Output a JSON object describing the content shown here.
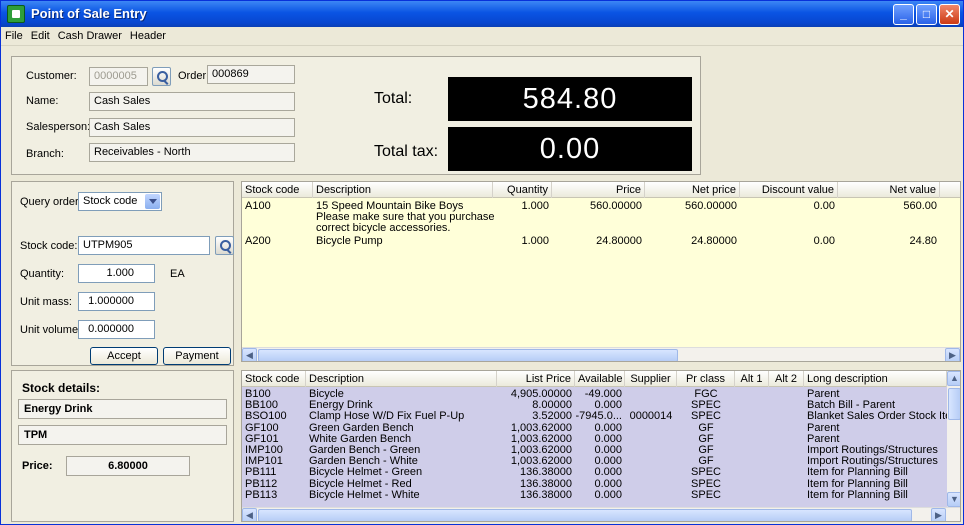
{
  "window": {
    "title": "Point of Sale Entry"
  },
  "menu": [
    "File",
    "Edit",
    "Cash Drawer",
    "Header"
  ],
  "header": {
    "customer_label": "Customer:",
    "customer_value": "0000005",
    "order_label": "Order:",
    "order_value": "000869",
    "name_label": "Name:",
    "name_value": "Cash Sales",
    "salesperson_label": "Salesperson:",
    "salesperson_value": "Cash Sales",
    "branch_label": "Branch:",
    "branch_value": "Receivables - North",
    "total_label": "Total:",
    "total_value": "584.80",
    "tax_label": "Total tax:",
    "tax_value": "0.00"
  },
  "entry": {
    "query_label": "Query order:",
    "query_value": "Stock code",
    "stock_label": "Stock code:",
    "stock_value": "UTPM905",
    "quantity_label": "Quantity:",
    "quantity_value": "1.000",
    "uom": "EA",
    "mass_label": "Unit mass:",
    "mass_value": "1.000000",
    "volume_label": "Unit volume:",
    "volume_value": "0.000000",
    "accept": "Accept",
    "payment": "Payment"
  },
  "order_grid": {
    "headers": [
      "Stock code",
      "Description",
      "Quantity",
      "Price",
      "Net price",
      "Discount value",
      "Net value"
    ],
    "rows": [
      {
        "code": "A100",
        "desc1": "15 Speed Mountain Bike Boys",
        "desc2": "Please make sure that you purchase the",
        "desc3": "correct bicycle accessories.",
        "qty": "1.000",
        "price": "560.00000",
        "net_price": "560.00000",
        "discount": "0.00",
        "net_value": "560.00"
      },
      {
        "code": "A200",
        "desc1": "Bicycle Pump",
        "qty": "1.000",
        "price": "24.80000",
        "net_price": "24.80000",
        "discount": "0.00",
        "net_value": "24.80"
      }
    ]
  },
  "stock_details": {
    "title": "Stock details:",
    "item": "Energy Drink",
    "uom": "TPM",
    "price_label": "Price:",
    "price_value": "6.80000"
  },
  "stock_grid": {
    "headers": [
      "Stock code",
      "Description",
      "List Price",
      "Available",
      "Supplier",
      "Pr class",
      "Alt 1",
      "Alt 2",
      "Long description"
    ],
    "rows": [
      {
        "code": "B100",
        "desc": "Bicycle",
        "list": "4,905.00000",
        "avail": "-49.000",
        "supplier": "",
        "prclass": "FGC",
        "long": "Parent"
      },
      {
        "code": "BB100",
        "desc": "Energy Drink",
        "list": "8.00000",
        "avail": "0.000",
        "supplier": "",
        "prclass": "SPEC",
        "long": "Batch Bill - Parent"
      },
      {
        "code": "BSO100",
        "desc": "Clamp Hose W/D Fix Fuel P-Up",
        "list": "3.52000",
        "avail": "-7945.0...",
        "supplier": "0000014",
        "prclass": "SPEC",
        "long": "Blanket Sales Order Stock Iter"
      },
      {
        "code": "GF100",
        "desc": "Green Garden Bench",
        "list": "1,003.62000",
        "avail": "0.000",
        "supplier": "",
        "prclass": "GF",
        "long": "Parent"
      },
      {
        "code": "GF101",
        "desc": "White Garden Bench",
        "list": "1,003.62000",
        "avail": "0.000",
        "supplier": "",
        "prclass": "GF",
        "long": "Parent"
      },
      {
        "code": "IMP100",
        "desc": "Garden Bench - Green",
        "list": "1,003.62000",
        "avail": "0.000",
        "supplier": "",
        "prclass": "GF",
        "long": "Import Routings/Structures"
      },
      {
        "code": "IMP101",
        "desc": "Garden Bench - White",
        "list": "1,003.62000",
        "avail": "0.000",
        "supplier": "",
        "prclass": "GF",
        "long": "Import Routings/Structures"
      },
      {
        "code": "PB111",
        "desc": "Bicycle Helmet - Green",
        "list": "136.38000",
        "avail": "0.000",
        "supplier": "",
        "prclass": "SPEC",
        "long": "Item for Planning Bill"
      },
      {
        "code": "PB112",
        "desc": "Bicycle Helmet - Red",
        "list": "136.38000",
        "avail": "0.000",
        "supplier": "",
        "prclass": "SPEC",
        "long": "Item for Planning Bill"
      },
      {
        "code": "PB113",
        "desc": "Bicycle Helmet - White",
        "list": "136.38000",
        "avail": "0.000",
        "supplier": "",
        "prclass": "SPEC",
        "long": "Item for Planning Bill"
      }
    ]
  },
  "colors": {
    "order_grid_bg": "#ffffd9",
    "stock_grid_bg": "#cfcde9",
    "titlebar": "#0a54e3"
  }
}
